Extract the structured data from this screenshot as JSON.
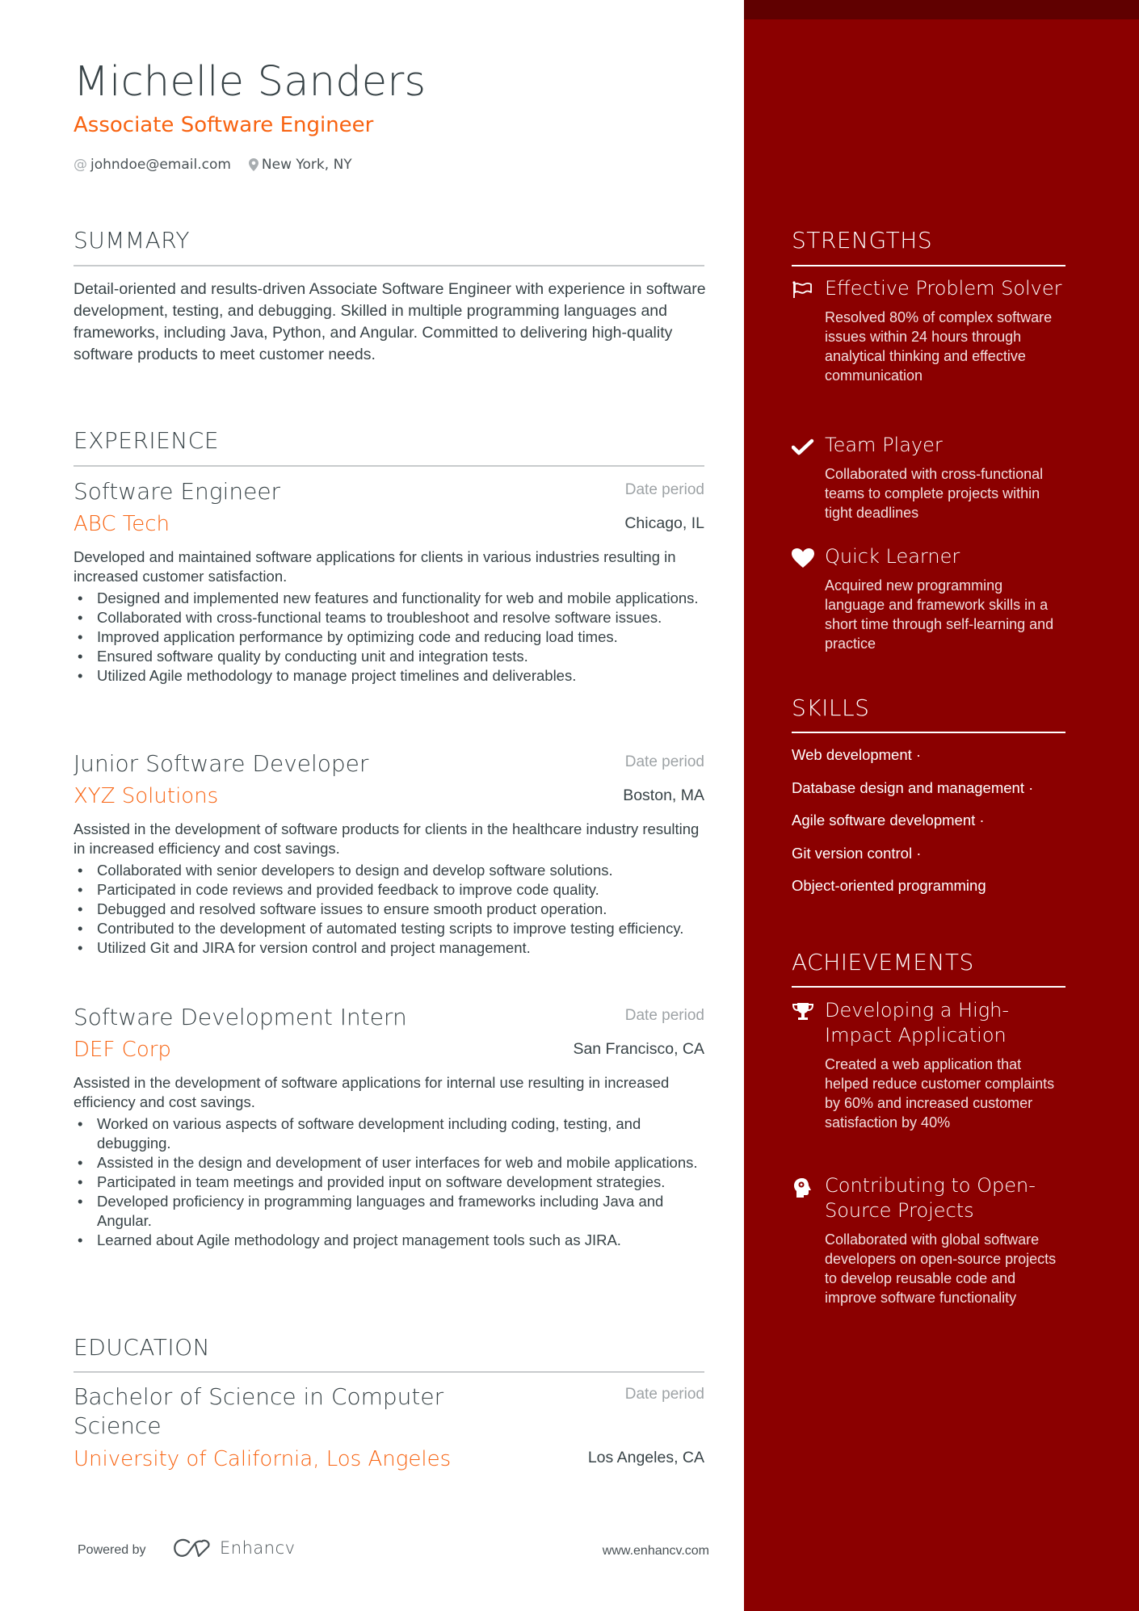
{
  "header": {
    "name": "Michelle Sanders",
    "title": "Associate Software Engineer",
    "email": "johndoe@email.com",
    "location": "New York, NY",
    "email_icon": "at-icon",
    "location_icon": "map-pin-icon"
  },
  "summary": {
    "heading": "SUMMARY",
    "text": "Detail-oriented and results-driven Associate Software Engineer with experience in software development, testing, and debugging. Skilled in multiple programming languages and frameworks, including Java, Python, and Angular. Committed to delivering high-quality software products to meet customer needs."
  },
  "experience": {
    "heading": "EXPERIENCE",
    "jobs": [
      {
        "title": "Software Engineer",
        "date": "Date period",
        "company": "ABC Tech",
        "location": "Chicago, IL",
        "description": "Developed and maintained software applications for clients in various industries resulting in increased customer satisfaction.",
        "bullets": [
          "Designed and implemented new features and functionality for web and mobile applications.",
          "Collaborated with cross-functional teams to troubleshoot and resolve software issues.",
          "Improved application performance by optimizing code and reducing load times.",
          "Ensured software quality by conducting unit and integration tests.",
          "Utilized Agile methodology to manage project timelines and deliverables."
        ]
      },
      {
        "title": "Junior Software Developer",
        "date": "Date period",
        "company": "XYZ Solutions",
        "location": "Boston, MA",
        "description": "Assisted in the development of software products for clients in the healthcare industry resulting in increased efficiency and cost savings.",
        "bullets": [
          "Collaborated with senior developers to design and develop software solutions.",
          "Participated in code reviews and provided feedback to improve code quality.",
          "Debugged and resolved software issues to ensure smooth product operation.",
          "Contributed to the development of automated testing scripts to improve testing efficiency.",
          "Utilized Git and JIRA for version control and project management."
        ]
      },
      {
        "title": "Software Development Intern",
        "date": "Date period",
        "company": "DEF Corp",
        "location": "San Francisco, CA",
        "description": "Assisted in the development of software applications for internal use resulting in increased efficiency and cost savings.",
        "bullets": [
          "Worked on various aspects of software development including coding, testing, and debugging.",
          "Assisted in the design and development of user interfaces for web and mobile applications.",
          "Participated in team meetings and provided input on software development strategies.",
          "Developed proficiency in programming languages and frameworks including Java and Angular.",
          "Learned about Agile methodology and project management tools such as JIRA."
        ]
      }
    ]
  },
  "education": {
    "heading": "EDUCATION",
    "degree": "Bachelor of Science in Computer Science",
    "date": "Date period",
    "school": "University of California, Los Angeles",
    "location": "Los Angeles, CA"
  },
  "footer": {
    "powered_by": "Powered by",
    "brand": "Enhancv",
    "website": "www.enhancv.com"
  },
  "strengths": {
    "heading": "STRENGTHS",
    "items": [
      {
        "icon": "flag-icon",
        "title": "Effective Problem Solver",
        "description": "Resolved 80% of complex software issues within 24 hours through analytical thinking and effective communication"
      },
      {
        "icon": "check-icon",
        "title": "Team Player",
        "description": "Collaborated with cross-functional teams to complete projects within tight deadlines"
      },
      {
        "icon": "heart-icon",
        "title": "Quick Learner",
        "description": "Acquired new programming language and framework skills in a short time through self-learning and practice"
      }
    ]
  },
  "skills": {
    "heading": "SKILLS",
    "items": [
      "Web development ·",
      "Database design and management ·",
      "Agile software development ·",
      "Git version control ·",
      "Object-oriented programming"
    ]
  },
  "achievements": {
    "heading": "ACHIEVEMENTS",
    "items": [
      {
        "icon": "trophy-icon",
        "title": "Developing a High-Impact Application",
        "description": "Created a web application that helped reduce customer complaints by 60% and increased customer satisfaction by 40%"
      },
      {
        "icon": "brain-head-icon",
        "title": "Contributing to Open-Source Projects",
        "description": "Collaborated with global software developers on open-source projects to develop reusable code and improve software functionality"
      }
    ]
  },
  "colors": {
    "accent": "#f86311",
    "sidebar": "#8b0000",
    "sidebar_top": "#600000",
    "text": "#384347",
    "muted": "#9ea3a6"
  }
}
